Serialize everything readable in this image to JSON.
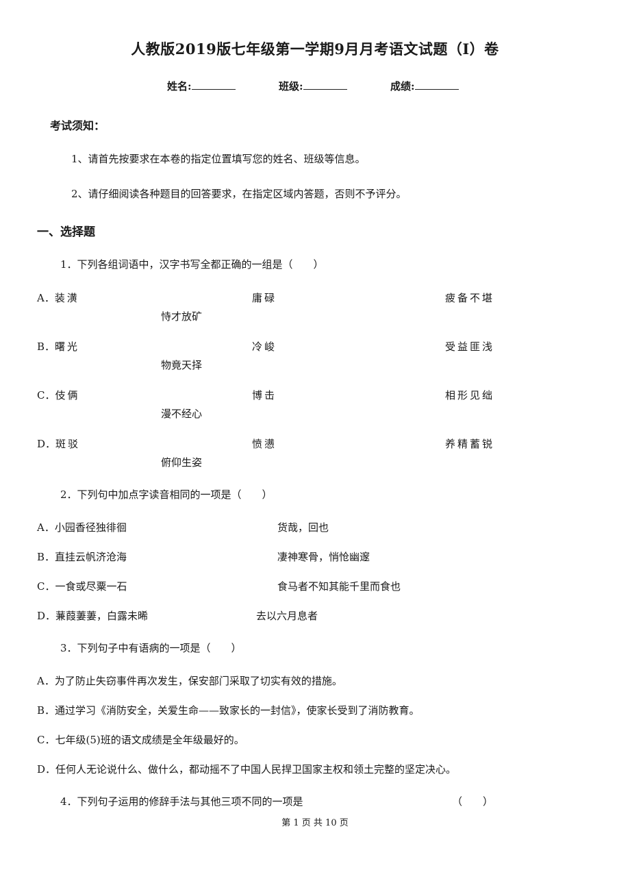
{
  "title": "人教版2019版七年级第一学期9月月考语文试题（I）卷",
  "info_fields": [
    {
      "label": "姓名:"
    },
    {
      "label": "班级:"
    },
    {
      "label": "成绩:"
    }
  ],
  "notice": {
    "heading": "考试须知：",
    "items": [
      "1、请首先按要求在本卷的指定位置填写您的姓名、班级等信息。",
      "2、请仔细阅读各种题目的回答要求，在指定区域内答题，否则不予评分。"
    ]
  },
  "section": {
    "title": "一、选择题"
  },
  "questions": [
    {
      "stem": "1．下列各组词语中，汉字书写全都正确的一组是（　　）",
      "options": [
        {
          "letter": "A．",
          "w1": "装潢",
          "w2": "庸碌",
          "w3": "疲备不堪",
          "w4": "恃才放矿"
        },
        {
          "letter": "B．",
          "w1": "曙光",
          "w2": "冷峻",
          "w3": "受益匪浅",
          "w4": "物竟天择"
        },
        {
          "letter": "C．",
          "w1": "伎俩",
          "w2": "博击",
          "w3": "相形见绌",
          "w4": "漫不经心"
        },
        {
          "letter": "D．",
          "w1": "斑驳",
          "w2": "愤懑",
          "w3": "养精蓄锐",
          "w4": "俯仰生姿"
        }
      ]
    },
    {
      "stem": "2．下列句中加点字读音相同的一项是（　　）",
      "options": [
        {
          "left": "A．小园香径独徘徊",
          "right": "货哉，回也"
        },
        {
          "left": "B．直挂云帆济沧海",
          "right": "凄神寒骨，悄怆幽邃"
        },
        {
          "left": "C．一食或尽粟一石",
          "right": "食马者不知其能千里而食也"
        },
        {
          "left": "D．蒹葭萋萋，白露未晞",
          "right": "去以六月息者"
        }
      ]
    },
    {
      "stem": "3．下列句子中有语病的一项是（　　）",
      "options": [
        "A．为了防止失窃事件再次发生，保安部门采取了切实有效的措施。",
        "B．通过学习《消防安全，关爱生命——致家长的一封信》，使家长受到了消防教育。",
        "C．七年级(5)班的语文成绩是全年级最好的。",
        "D．任何人无论说什么、做什么，都动摇不了中国人民捍卫国家主权和领土完整的坚定决心。"
      ]
    },
    {
      "stem": "4．下列句子运用的修辞手法与其他三项不同的一项是",
      "paren": "（　　）"
    }
  ],
  "footer": "第 1 页 共 10 页"
}
